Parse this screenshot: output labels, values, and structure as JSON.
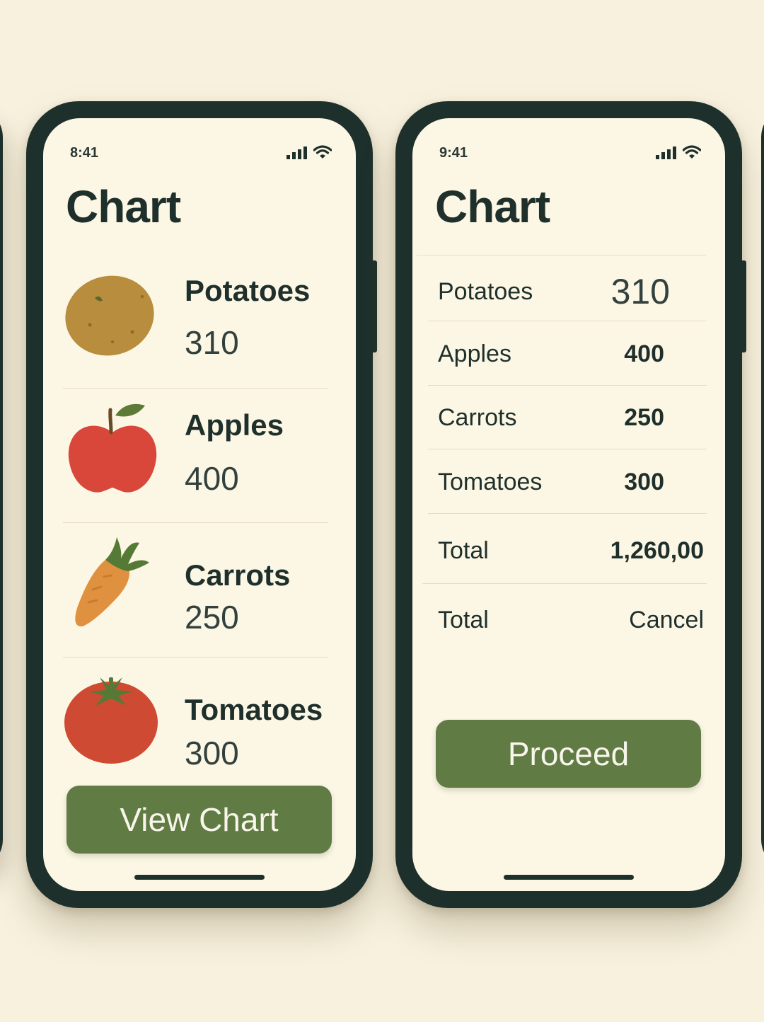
{
  "left_screen": {
    "status_time": "8:41",
    "title": "Chart",
    "items": [
      {
        "name": "Potatoes",
        "count": "310",
        "icon": "potato-icon"
      },
      {
        "name": "Apples",
        "count": "400",
        "icon": "apple-icon"
      },
      {
        "name": "Carrots",
        "count": "250",
        "icon": "carrot-icon"
      },
      {
        "name": "Tomatoes",
        "count": "300",
        "icon": "tomato-icon"
      }
    ],
    "button_label": "View Chart"
  },
  "right_screen": {
    "status_time": "9:41",
    "title": "Chart",
    "rows": [
      {
        "label": "Potatoes",
        "value": "310"
      },
      {
        "label": "Apples",
        "value": "400"
      },
      {
        "label": "Carrots",
        "value": "250"
      },
      {
        "label": "Tomatoes",
        "value": "300"
      },
      {
        "label": "Total",
        "value": "1,260,00"
      },
      {
        "label": "Total",
        "value": "Cancel"
      }
    ],
    "button_label": "Proceed"
  },
  "colors": {
    "background": "#f7f1de",
    "screen": "#fcf7e5",
    "frame": "#1e302c",
    "button": "#617b45",
    "text": "#1f302c"
  }
}
